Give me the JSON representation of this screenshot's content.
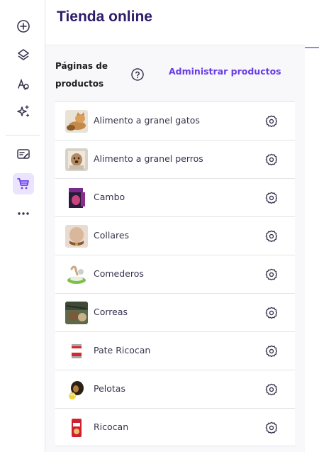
{
  "panel": {
    "title": "Tienda online"
  },
  "section": {
    "title": "Páginas de productos",
    "manage_link": "Administrar productos"
  },
  "products": [
    {
      "label": "Alimento a granel gatos",
      "thumb": "cat-food-thumbnail"
    },
    {
      "label": "Alimento a granel perros",
      "thumb": "dog-food-thumbnail"
    },
    {
      "label": "Cambo",
      "thumb": "cambo-package-thumbnail"
    },
    {
      "label": "Collares",
      "thumb": "collar-thumbnail"
    },
    {
      "label": "Comederos",
      "thumb": "feeder-thumbnail"
    },
    {
      "label": "Correas",
      "thumb": "leash-thumbnail"
    },
    {
      "label": "Pate Ricocan",
      "thumb": "pate-can-thumbnail"
    },
    {
      "label": "Pelotas",
      "thumb": "ball-dog-thumbnail"
    },
    {
      "label": "Ricocan",
      "thumb": "ricocan-bag-thumbnail"
    }
  ],
  "rail": {
    "icons": [
      "add-icon",
      "layers-icon",
      "typography-icon",
      "ai-sparkle-icon",
      "edit-list-icon",
      "cart-icon",
      "more-icon"
    ],
    "active": "cart-icon"
  },
  "colors": {
    "accent": "#673de6",
    "title": "#2f1c6a",
    "active_bg": "#ebe4ff"
  }
}
